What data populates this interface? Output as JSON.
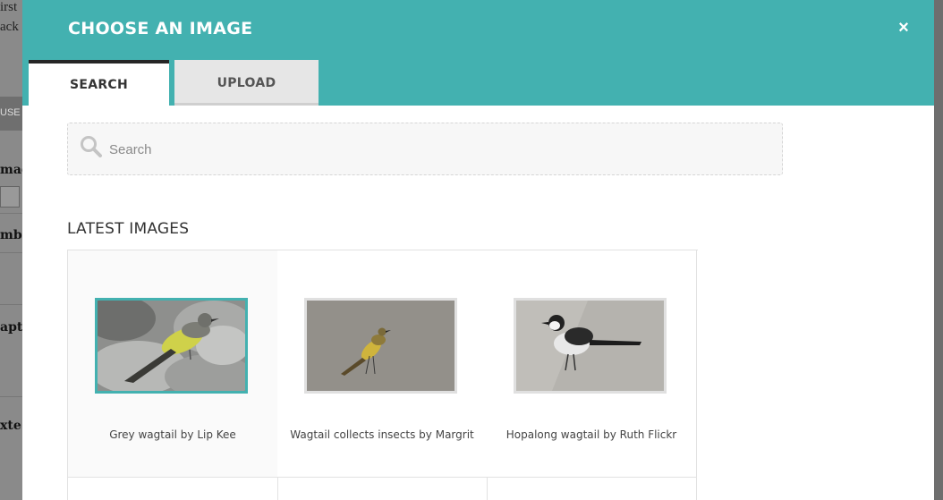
{
  "background": {
    "text_lines": [
      "irst",
      "ack"
    ],
    "strip_label": "USE",
    "labels": [
      "mag",
      "mbe",
      "apt",
      "xte"
    ]
  },
  "modal": {
    "title": "CHOOSE AN IMAGE",
    "close_icon": "×",
    "tabs": [
      {
        "label": "SEARCH",
        "active": true
      },
      {
        "label": "UPLOAD",
        "active": false
      }
    ],
    "search": {
      "placeholder": "Search",
      "value": ""
    },
    "section_title": "LATEST IMAGES",
    "images": [
      {
        "caption": "Grey wagtail by Lip Kee",
        "selected": true
      },
      {
        "caption": "Wagtail collects insects by Margrit",
        "selected": false
      },
      {
        "caption": "Hopalong wagtail by Ruth Flickr",
        "selected": false
      }
    ]
  },
  "colors": {
    "accent": "#43b1b0",
    "overlay": "#8a8a8a"
  }
}
